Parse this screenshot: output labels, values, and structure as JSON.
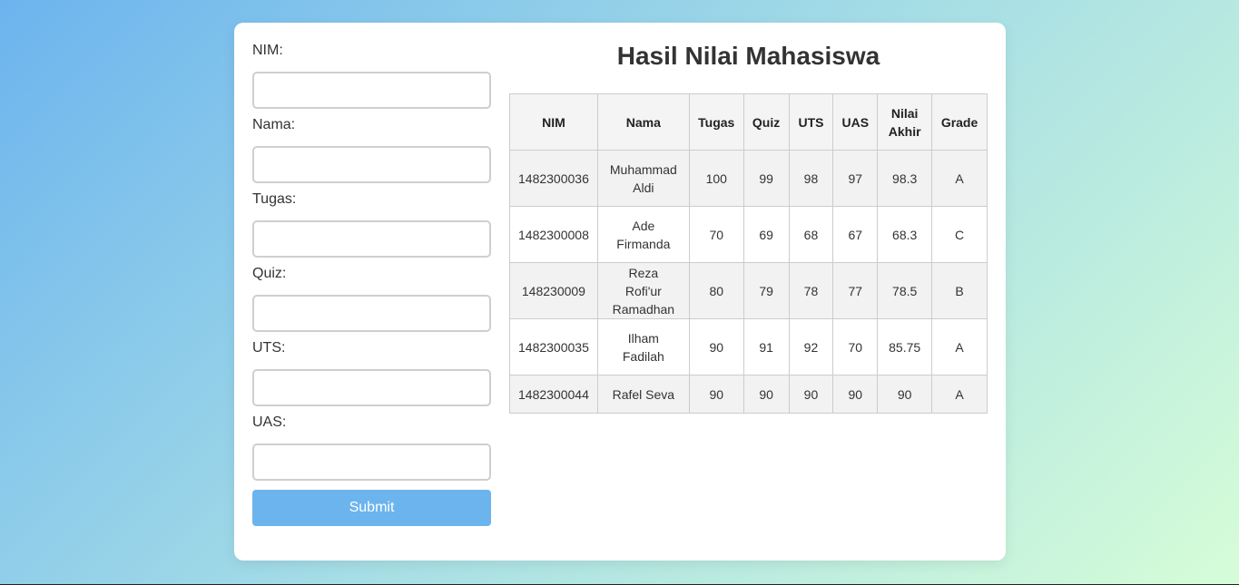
{
  "form": {
    "fields": [
      {
        "label": "NIM:",
        "value": ""
      },
      {
        "label": "Nama:",
        "value": ""
      },
      {
        "label": "Tugas:",
        "value": ""
      },
      {
        "label": "Quiz:",
        "value": ""
      },
      {
        "label": "UTS:",
        "value": ""
      },
      {
        "label": "UAS:",
        "value": ""
      }
    ],
    "submit_label": "Submit"
  },
  "results": {
    "title": "Hasil Nilai Mahasiswa",
    "columns": [
      "NIM",
      "Nama",
      "Tugas",
      "Quiz",
      "UTS",
      "UAS",
      "Nilai Akhir",
      "Grade"
    ],
    "rows": [
      [
        "1482300036",
        "Muhammad Aldi",
        "100",
        "99",
        "98",
        "97",
        "98.3",
        "A"
      ],
      [
        "1482300008",
        "Ade Firmanda",
        "70",
        "69",
        "68",
        "67",
        "68.3",
        "C"
      ],
      [
        "148230009",
        "Reza Rofi'ur Ramadhan",
        "80",
        "79",
        "78",
        "77",
        "78.5",
        "B"
      ],
      [
        "1482300035",
        "Ilham Fadilah",
        "90",
        "91",
        "92",
        "70",
        "85.75",
        "A"
      ],
      [
        "1482300044",
        "Rafel Seva",
        "90",
        "90",
        "90",
        "90",
        "90",
        "A"
      ]
    ]
  },
  "colors": {
    "accent": "#6cb4ee",
    "gradient_start": "#6cb4ee",
    "gradient_end": "#d6fdd8"
  }
}
